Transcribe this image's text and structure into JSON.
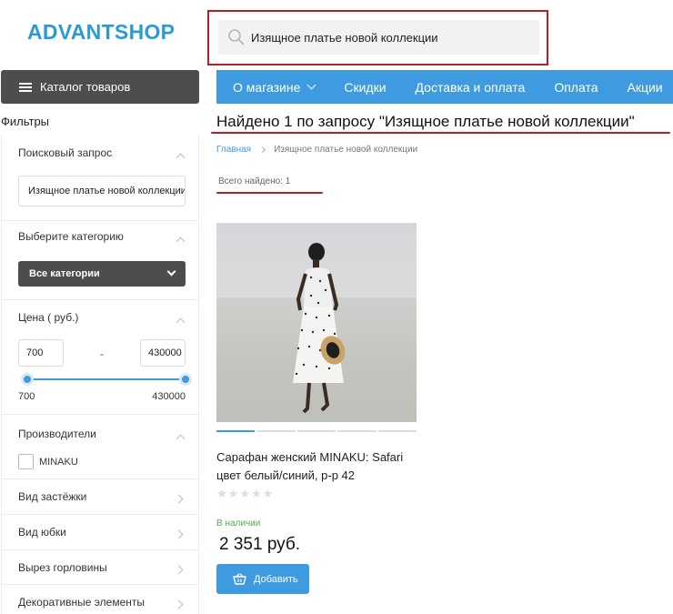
{
  "header": {
    "logo": "ADVANTSHOP",
    "search": {
      "value": "Изящное платье новой коллекции",
      "icon": "search-icon"
    }
  },
  "catalog_button": {
    "label": "Каталог товаров",
    "icon": "menu-icon"
  },
  "nav": {
    "items": [
      "О магазине",
      "Скидки",
      "Доставка и оплата",
      "Оплата",
      "Акции"
    ]
  },
  "colors": {
    "brand": "#2a9bd6",
    "nav_bg": "#3f9be0",
    "dark_button": "#4d4d4d",
    "annotation_red": "#b3202a",
    "in_stock": "#4caf50"
  },
  "filters": {
    "title": "Фильтры",
    "query": {
      "title": "Поисковый запрос",
      "value": "Изящное платье новой коллекции"
    },
    "category": {
      "title": "Выберите категорию",
      "selected": "Все категории"
    },
    "price": {
      "title": "Цена ( руб.)",
      "min_value": "700",
      "max_value": "430000",
      "separator": "-",
      "min_label": "700",
      "max_label": "430000"
    },
    "manufacturers": {
      "title": "Производители",
      "options": [
        "MINAKU"
      ]
    },
    "collapsed": [
      "Вид застёжки",
      "Вид юбки",
      "Вырез горловины",
      "Декоративные элементы"
    ]
  },
  "results": {
    "title": "Найдено 1 по запросу \"Изящное платье новой коллекции\"",
    "breadcrumb": {
      "home": "Главная",
      "current": "Изящное платье новой коллекции"
    },
    "total_found": "Всего найдено: 1"
  },
  "product": {
    "name": "Сарафан женский MINAKU: Safari цвет белый/синий, р-р 42",
    "rating": 0,
    "rating_max": 5,
    "availability": "В наличии",
    "price": "2 351 руб.",
    "add_button": "Добавить",
    "photo_count": 5
  }
}
